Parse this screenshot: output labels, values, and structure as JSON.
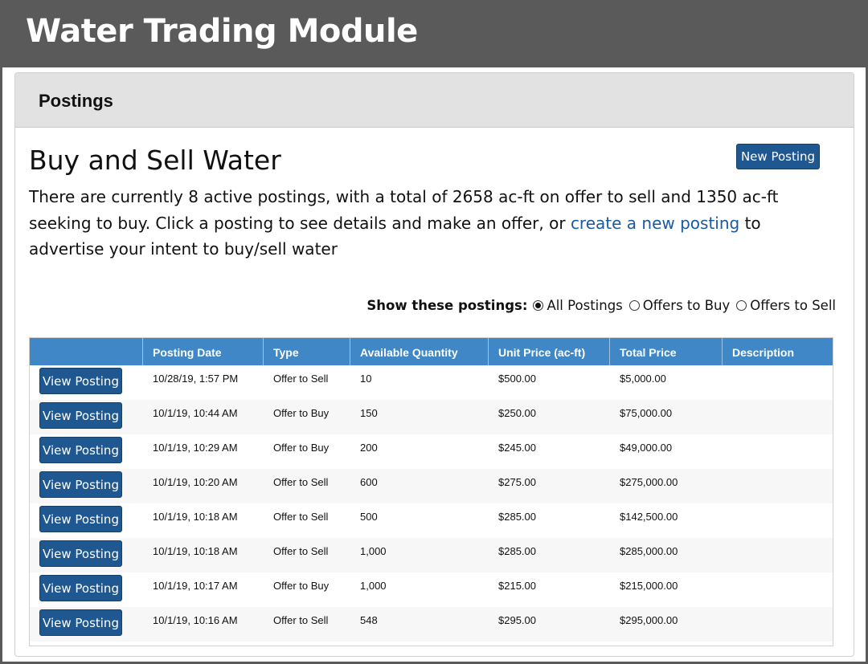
{
  "app": {
    "title": "Water Trading Module"
  },
  "panel": {
    "title": "Postings"
  },
  "page": {
    "heading": "Buy and Sell Water",
    "new_posting_label": "New Posting",
    "intro_part1": "There are currently 8 active postings, with a total of 2658 ac-ft on offer to sell and 1350 ac-ft seeking to buy. Click a posting to see details and make an offer, or ",
    "intro_link": "create a new posting",
    "intro_part2": " to advertise your intent to buy/sell water"
  },
  "filter": {
    "label": "Show these postings:",
    "options": [
      {
        "label": "All Postings",
        "selected": true
      },
      {
        "label": "Offers to Buy",
        "selected": false
      },
      {
        "label": "Offers to Sell",
        "selected": false
      }
    ]
  },
  "table": {
    "headers": [
      "Posting Date",
      "Type",
      "Available Quantity",
      "Unit Price (ac-ft)",
      "Total Price",
      "Description"
    ],
    "view_label": "View Posting",
    "rows": [
      {
        "date": "10/28/19, 1:57 PM",
        "type": "Offer to Sell",
        "quantity": "10",
        "unit_price": "$500.00",
        "total_price": "$5,000.00",
        "description": ""
      },
      {
        "date": "10/1/19, 10:44 AM",
        "type": "Offer to Buy",
        "quantity": "150",
        "unit_price": "$250.00",
        "total_price": "$75,000.00",
        "description": ""
      },
      {
        "date": "10/1/19, 10:29 AM",
        "type": "Offer to Buy",
        "quantity": "200",
        "unit_price": "$245.00",
        "total_price": "$49,000.00",
        "description": ""
      },
      {
        "date": "10/1/19, 10:20 AM",
        "type": "Offer to Sell",
        "quantity": "600",
        "unit_price": "$275.00",
        "total_price": "$275,000.00",
        "description": ""
      },
      {
        "date": "10/1/19, 10:18 AM",
        "type": "Offer to Sell",
        "quantity": "500",
        "unit_price": "$285.00",
        "total_price": "$142,500.00",
        "description": ""
      },
      {
        "date": "10/1/19, 10:18 AM",
        "type": "Offer to Sell",
        "quantity": "1,000",
        "unit_price": "$285.00",
        "total_price": "$285,000.00",
        "description": ""
      },
      {
        "date": "10/1/19, 10:17 AM",
        "type": "Offer to Buy",
        "quantity": "1,000",
        "unit_price": "$215.00",
        "total_price": "$215,000.00",
        "description": ""
      },
      {
        "date": "10/1/19, 10:16 AM",
        "type": "Offer to Sell",
        "quantity": "548",
        "unit_price": "$295.00",
        "total_price": "$295,000.00",
        "description": ""
      }
    ]
  },
  "colors": {
    "header_bar": "#5a5a5a",
    "button": "#1f5790",
    "table_header": "#3f87c7",
    "link": "#1b5aa0"
  }
}
